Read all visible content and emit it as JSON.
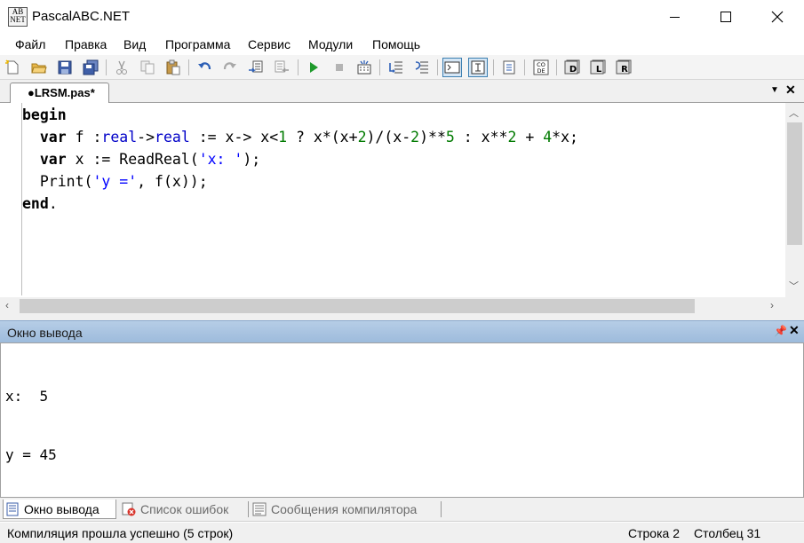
{
  "window": {
    "title": "PascalABC.NET",
    "icon": "pascalabc-app-icon",
    "icon_text": [
      "AB",
      "NET"
    ]
  },
  "menu": [
    "Файл",
    "Правка",
    "Вид",
    "Программа",
    "Сервис",
    "Модули",
    "Помощь"
  ],
  "toolbar": {
    "buttons": [
      "new-file",
      "open-file",
      "save",
      "save-all",
      "cut",
      "copy",
      "paste",
      "undo",
      "redo",
      "indent",
      "unindent",
      "run",
      "stop",
      "compile",
      "step-into",
      "step-over",
      "output-window",
      "show-text",
      "collapse-regions",
      "code-templates",
      "debug-d",
      "debug-l",
      "debug-r"
    ],
    "icon_glyphs": {
      "code_templates": [
        "CO",
        "DE"
      ],
      "debug_d": "D",
      "debug_l": "L",
      "debug_r": "R"
    }
  },
  "document_tab": {
    "label": "●LRSM.pas*"
  },
  "editor": {
    "lines": [
      [
        {
          "t": "begin",
          "c": "kw"
        }
      ],
      [
        {
          "t": "  var",
          "c": "kw"
        },
        {
          "t": " f :"
        },
        {
          "t": "real",
          "c": "ty"
        },
        {
          "t": "->"
        },
        {
          "t": "real",
          "c": "ty"
        },
        {
          "t": " := x-> x<"
        },
        {
          "t": "1",
          "c": "num"
        },
        {
          "t": " ? x*(x+"
        },
        {
          "t": "2",
          "c": "num"
        },
        {
          "t": ")/(x-"
        },
        {
          "t": "2",
          "c": "num"
        },
        {
          "t": ")**"
        },
        {
          "t": "5",
          "c": "num"
        },
        {
          "t": " : x**"
        },
        {
          "t": "2",
          "c": "num"
        },
        {
          "t": " + "
        },
        {
          "t": "4",
          "c": "num"
        },
        {
          "t": "*x;"
        }
      ],
      [
        {
          "t": "  var",
          "c": "kw"
        },
        {
          "t": " x := ReadReal("
        },
        {
          "t": "'x: '",
          "c": "str"
        },
        {
          "t": ");"
        }
      ],
      [
        {
          "t": "  Print("
        },
        {
          "t": "'y ='",
          "c": "str"
        },
        {
          "t": ", f(x));"
        }
      ],
      [
        {
          "t": "end",
          "c": "kw"
        },
        {
          "t": "."
        }
      ]
    ]
  },
  "output_panel": {
    "title": "Окно вывода",
    "lines": [
      "x:  5",
      "y = 45"
    ]
  },
  "bottom_tabs": [
    {
      "label": "Окно вывода",
      "icon": "output-window-icon",
      "active": true
    },
    {
      "label": "Список ошибок",
      "icon": "error-list-icon",
      "active": false
    },
    {
      "label": "Сообщения компилятора",
      "icon": "compiler-messages-icon",
      "active": false
    }
  ],
  "status": {
    "message": "Компиляция прошла успешно (5 строк)",
    "row_label": "Строка",
    "row_value": "2",
    "col_label": "Столбец",
    "col_value": "31"
  },
  "colors": {
    "keyword": "#000000",
    "type": "#0000c8",
    "number": "#007a00",
    "string": "#0000ff",
    "panel_header": "#b6cde6"
  }
}
